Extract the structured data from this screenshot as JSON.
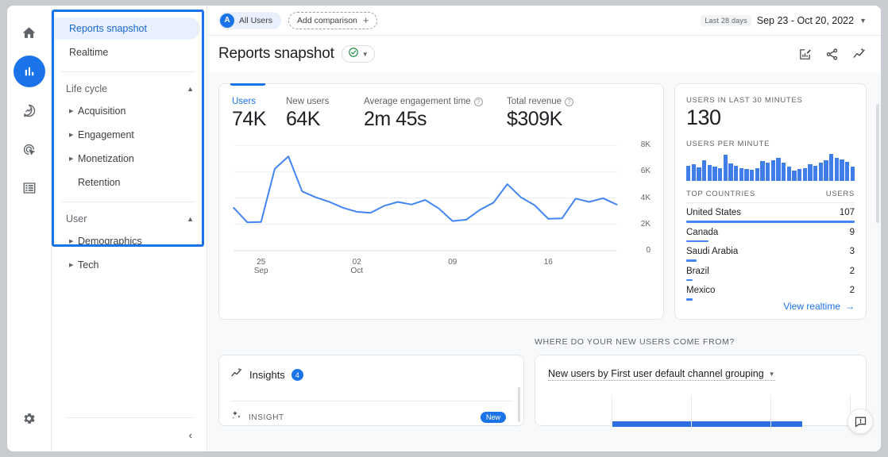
{
  "rail": {
    "items": [
      {
        "name": "home",
        "icon": "home-icon",
        "active": false
      },
      {
        "name": "reports",
        "icon": "bar-chart-icon",
        "active": true
      },
      {
        "name": "explore",
        "icon": "explore-bubble-icon",
        "active": false
      },
      {
        "name": "advertising",
        "icon": "target-cursor-icon",
        "active": false
      },
      {
        "name": "library",
        "icon": "library-list-icon",
        "active": false
      }
    ],
    "settings_icon": "gear-icon"
  },
  "sidebar": {
    "top_items": [
      {
        "label": "Reports snapshot",
        "selected": true
      },
      {
        "label": "Realtime",
        "selected": false
      }
    ],
    "groups": [
      {
        "title": "Life cycle",
        "items": [
          {
            "label": "Acquisition",
            "expandable": true
          },
          {
            "label": "Engagement",
            "expandable": true
          },
          {
            "label": "Monetization",
            "expandable": true
          },
          {
            "label": "Retention",
            "expandable": false
          }
        ]
      },
      {
        "title": "User",
        "items": [
          {
            "label": "Demographics",
            "expandable": true
          },
          {
            "label": "Tech",
            "expandable": true
          }
        ]
      }
    ],
    "collapse_icon": "chevron-left-icon"
  },
  "topbar": {
    "audience_avatar": "A",
    "audience_label": "All Users",
    "add_comparison_label": "Add comparison",
    "date_badge": "Last 28 days",
    "date_range": "Sep 23 - Oct 20, 2022"
  },
  "header": {
    "title": "Reports snapshot",
    "status_icon": "check-circle-icon",
    "actions": [
      {
        "name": "customize-report-icon"
      },
      {
        "name": "share-icon"
      },
      {
        "name": "insights-icon"
      }
    ]
  },
  "metrics": [
    {
      "label": "Users",
      "value": "74K",
      "has_help": false,
      "active": true
    },
    {
      "label": "New users",
      "value": "64K",
      "has_help": false,
      "active": false
    },
    {
      "label": "Average engagement time",
      "value": "2m 45s",
      "has_help": true,
      "active": false
    },
    {
      "label": "Total revenue",
      "value": "$309K",
      "has_help": true,
      "active": false
    }
  ],
  "realtime": {
    "users_label": "USERS IN LAST 30 MINUTES",
    "users_value": "130",
    "per_minute_label": "USERS PER MINUTE",
    "table_head_left": "TOP COUNTRIES",
    "table_head_right": "USERS",
    "countries": [
      {
        "name": "United States",
        "users": "107",
        "pct": 100
      },
      {
        "name": "Canada",
        "users": "9",
        "pct": 13
      },
      {
        "name": "Saudi Arabia",
        "users": "3",
        "pct": 6
      },
      {
        "name": "Brazil",
        "users": "2",
        "pct": 4
      },
      {
        "name": "Mexico",
        "users": "2",
        "pct": 4
      }
    ],
    "link_label": "View realtime",
    "link_icon": "arrow-right-icon"
  },
  "insights": {
    "title": "Insights",
    "count": "4",
    "row_label": "INSIGHT",
    "row_badge": "New",
    "icon": "insights-sparkline-icon",
    "row_icon": "sparkle-icon"
  },
  "new_users_card": {
    "section_caption": "WHERE DO YOUR NEW USERS COME FROM?",
    "title": "New users by First user default channel grouping"
  },
  "feedback": {
    "icon": "feedback-icon"
  },
  "chart_data": {
    "type": "line",
    "title": "Users over time",
    "xlabel": "",
    "ylabel": "Users",
    "ylim": [
      0,
      8000
    ],
    "yticks": [
      "0",
      "2K",
      "4K",
      "6K",
      "8K"
    ],
    "ytick_values": [
      0,
      2000,
      4000,
      6000,
      8000
    ],
    "grid": true,
    "legend": "none",
    "xticks": [
      {
        "pos": 2,
        "line1": "25",
        "line2": "Sep"
      },
      {
        "pos": 9,
        "line1": "02",
        "line2": "Oct"
      },
      {
        "pos": 16,
        "line1": "09",
        "line2": ""
      },
      {
        "pos": 23,
        "line1": "16",
        "line2": ""
      }
    ],
    "series": [
      {
        "name": "Users",
        "color": "#4285f4",
        "values": [
          3250,
          2150,
          2180,
          6200,
          7150,
          4500,
          4050,
          3700,
          3250,
          2950,
          2870,
          3400,
          3700,
          3500,
          3850,
          3200,
          2250,
          2350,
          3100,
          3650,
          5050,
          4050,
          3450,
          2420,
          2450,
          3950,
          3700,
          3980,
          3500
        ]
      }
    ],
    "realtime_sparkline": {
      "type": "bar",
      "label": "Users per minute",
      "color": "#3f7ee8",
      "values": [
        52,
        58,
        47,
        70,
        55,
        48,
        44,
        88,
        60,
        52,
        44,
        40,
        38,
        42,
        68,
        62,
        70,
        78,
        62,
        48,
        34,
        40,
        42,
        58,
        52,
        62,
        70,
        92,
        78,
        72,
        66,
        48
      ]
    },
    "new_users_bar": {
      "type": "bar",
      "orientation": "horizontal",
      "values": [
        100
      ],
      "color": "#2d6fe0",
      "gridlines": 4
    }
  }
}
